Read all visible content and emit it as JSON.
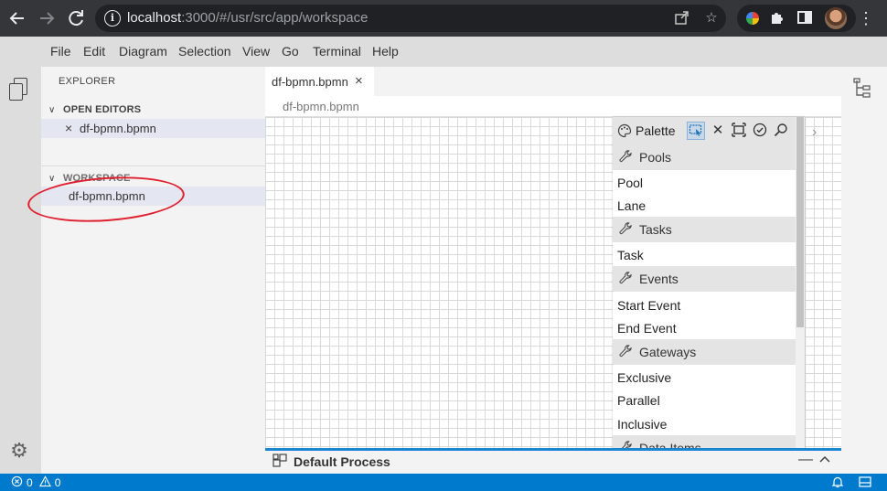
{
  "browser": {
    "url_host": "localhost",
    "url_path": ":3000/#/usr/src/app/workspace",
    "icons": [
      "back-arrow-icon",
      "forward-arrow-icon",
      "reload-icon",
      "site-info-icon",
      "share-icon",
      "bookmark-star-icon",
      "extension-icon",
      "puzzle-icon",
      "sidepanel-icon",
      "avatar",
      "kebab-menu-icon"
    ]
  },
  "menubar": {
    "items": [
      "File",
      "Edit",
      "Diagram",
      "Selection",
      "View",
      "Go",
      "Terminal",
      "Help"
    ]
  },
  "explorer": {
    "title": "EXPLORER",
    "open_editors": {
      "header": "OPEN EDITORS",
      "files": [
        "df-bpmn.bpmn"
      ]
    },
    "workspace": {
      "header": "WORKSPACE",
      "files": [
        "df-bpmn.bpmn"
      ]
    }
  },
  "editor": {
    "tab_label": "df-bpmn.bpmn",
    "breadcrumb": "df-bpmn.bpmn"
  },
  "palette": {
    "title": "Palette",
    "groups": [
      {
        "label": "Pools",
        "items": [
          "Pool",
          "Lane"
        ]
      },
      {
        "label": "Tasks",
        "items": [
          "Task"
        ]
      },
      {
        "label": "Events",
        "items": [
          "Start Event",
          "End Event"
        ]
      },
      {
        "label": "Gateways",
        "items": [
          "Exclusive",
          "Parallel",
          "Inclusive"
        ]
      },
      {
        "label": "Data Items",
        "items": []
      }
    ]
  },
  "panel": {
    "title": "Default Process"
  },
  "statusbar": {
    "errors": "0",
    "warnings": "0"
  },
  "colors": {
    "accent": "#007acc",
    "panel_border": "#1a85d0",
    "annotation": "#e01f2e",
    "selection": "#e4e6f1"
  }
}
